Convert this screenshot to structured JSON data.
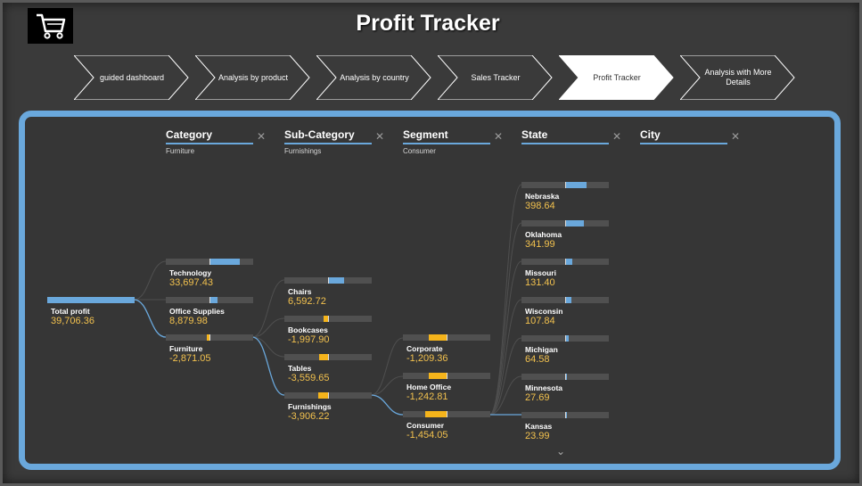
{
  "header": {
    "title": "Profit Tracker",
    "logo_icon": "shopping-cart-icon"
  },
  "nav": {
    "items": [
      {
        "label": "guided dashboard",
        "active": false
      },
      {
        "label": "Analysis by product",
        "active": false
      },
      {
        "label": "Analysis by country",
        "active": false
      },
      {
        "label": "Sales Tracker",
        "active": false
      },
      {
        "label": "Profit Tracker",
        "active": true
      },
      {
        "label": "Analysis with More Details",
        "active": false
      }
    ]
  },
  "tree": {
    "columns": [
      {
        "name": "Category",
        "selected": "Furniture"
      },
      {
        "name": "Sub-Category",
        "selected": "Furnishings"
      },
      {
        "name": "Segment",
        "selected": "Consumer"
      },
      {
        "name": "State",
        "selected": ""
      },
      {
        "name": "City",
        "selected": ""
      }
    ],
    "root": {
      "label": "Total profit",
      "value": "39,706.36",
      "amount": 39706.36
    },
    "category": [
      {
        "label": "Technology",
        "value": "33,697.43",
        "amount": 33697.43
      },
      {
        "label": "Office Supplies",
        "value": "8,879.98",
        "amount": 8879.98
      },
      {
        "label": "Furniture",
        "value": "-2,871.05",
        "amount": -2871.05
      }
    ],
    "subcategory": [
      {
        "label": "Chairs",
        "value": "6,592.72",
        "amount": 6592.72
      },
      {
        "label": "Bookcases",
        "value": "-1,997.90",
        "amount": -1997.9
      },
      {
        "label": "Tables",
        "value": "-3,559.65",
        "amount": -3559.65
      },
      {
        "label": "Furnishings",
        "value": "-3,906.22",
        "amount": -3906.22
      }
    ],
    "segment": [
      {
        "label": "Corporate",
        "value": "-1,209.36",
        "amount": -1209.36
      },
      {
        "label": "Home Office",
        "value": "-1,242.81",
        "amount": -1242.81
      },
      {
        "label": "Consumer",
        "value": "-1,454.05",
        "amount": -1454.05
      }
    ],
    "state": [
      {
        "label": "Nebraska",
        "value": "398.64",
        "amount": 398.64
      },
      {
        "label": "Oklahoma",
        "value": "341.99",
        "amount": 341.99
      },
      {
        "label": "Missouri",
        "value": "131.40",
        "amount": 131.4
      },
      {
        "label": "Wisconsin",
        "value": "107.84",
        "amount": 107.84
      },
      {
        "label": "Michigan",
        "value": "64.58",
        "amount": 64.58
      },
      {
        "label": "Minnesota",
        "value": "27.69",
        "amount": 27.69
      },
      {
        "label": "Kansas",
        "value": "23.99",
        "amount": 23.99
      }
    ]
  },
  "colors": {
    "positive": "#6aa8dc",
    "negative": "#f5b41b",
    "value_text": "#f2c14e",
    "panel_border": "#6aa8dc"
  }
}
